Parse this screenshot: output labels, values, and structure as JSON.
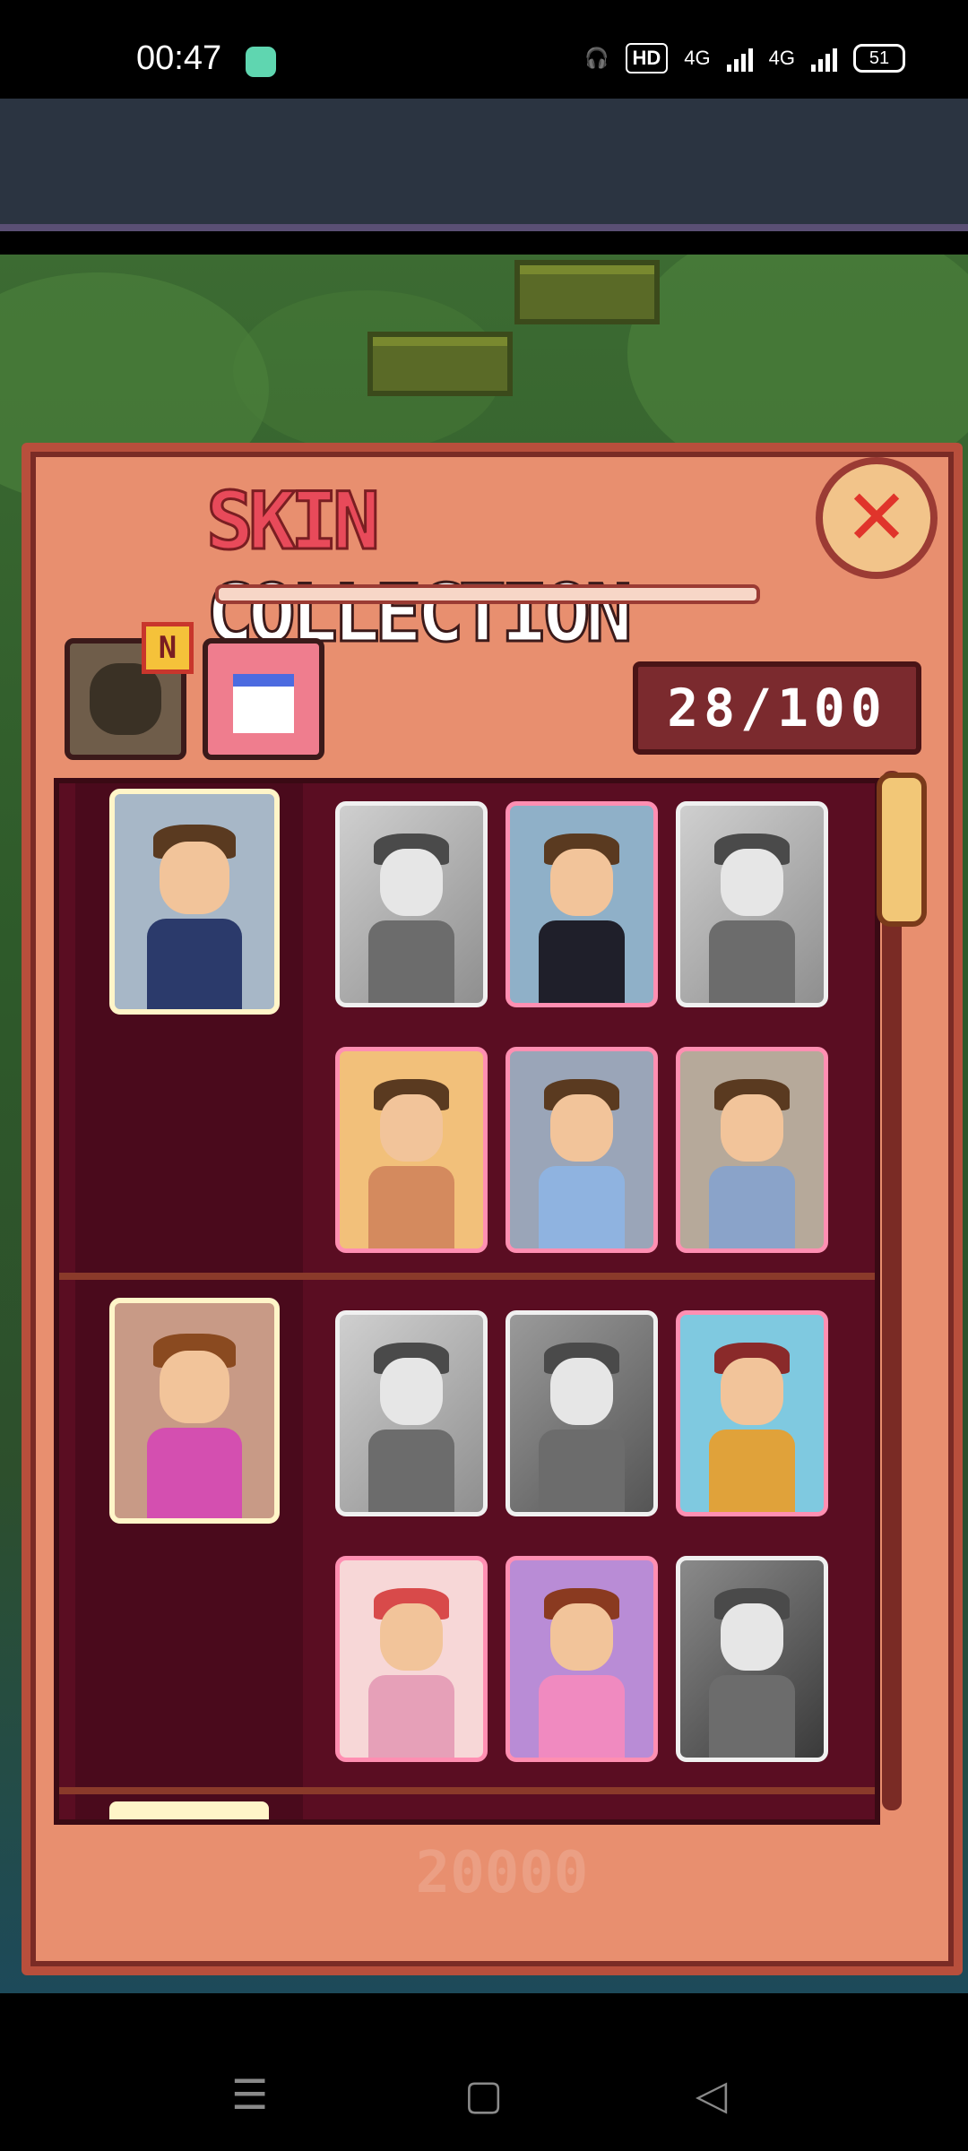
{
  "status_bar": {
    "time": "00:47",
    "hd_label": "HD",
    "network_1": "4G",
    "network_2": "4G",
    "battery": "51"
  },
  "panel": {
    "title_part1": "SKIN",
    "title_part2": "COLLECTION",
    "new_badge": "N",
    "counter": "28/100",
    "footer_faint": "20000"
  },
  "icons": {
    "close": "close-icon",
    "hair_tab": "hair-icon",
    "shirt_tab": "shirt-icon",
    "nav_menu": "menu-icon",
    "nav_home": "home-icon",
    "nav_back": "back-icon"
  },
  "colors": {
    "panel": "#e88f6f",
    "panel_border": "#b84f3c",
    "list_bg": "#5a0d22",
    "unlocked_border": "#ff8fb2",
    "locked_border": "#f0f0f0",
    "title_red": "#e84a5a"
  },
  "characters": [
    {
      "name": "man",
      "skins": [
        {
          "state": "locked"
        },
        {
          "state": "unlocked"
        },
        {
          "state": "locked"
        },
        {
          "state": "unlocked"
        },
        {
          "state": "unlocked"
        },
        {
          "state": "unlocked"
        }
      ]
    },
    {
      "name": "woman",
      "skins": [
        {
          "state": "locked"
        },
        {
          "state": "locked"
        },
        {
          "state": "unlocked"
        },
        {
          "state": "unlocked"
        },
        {
          "state": "unlocked"
        },
        {
          "state": "locked"
        }
      ]
    }
  ]
}
